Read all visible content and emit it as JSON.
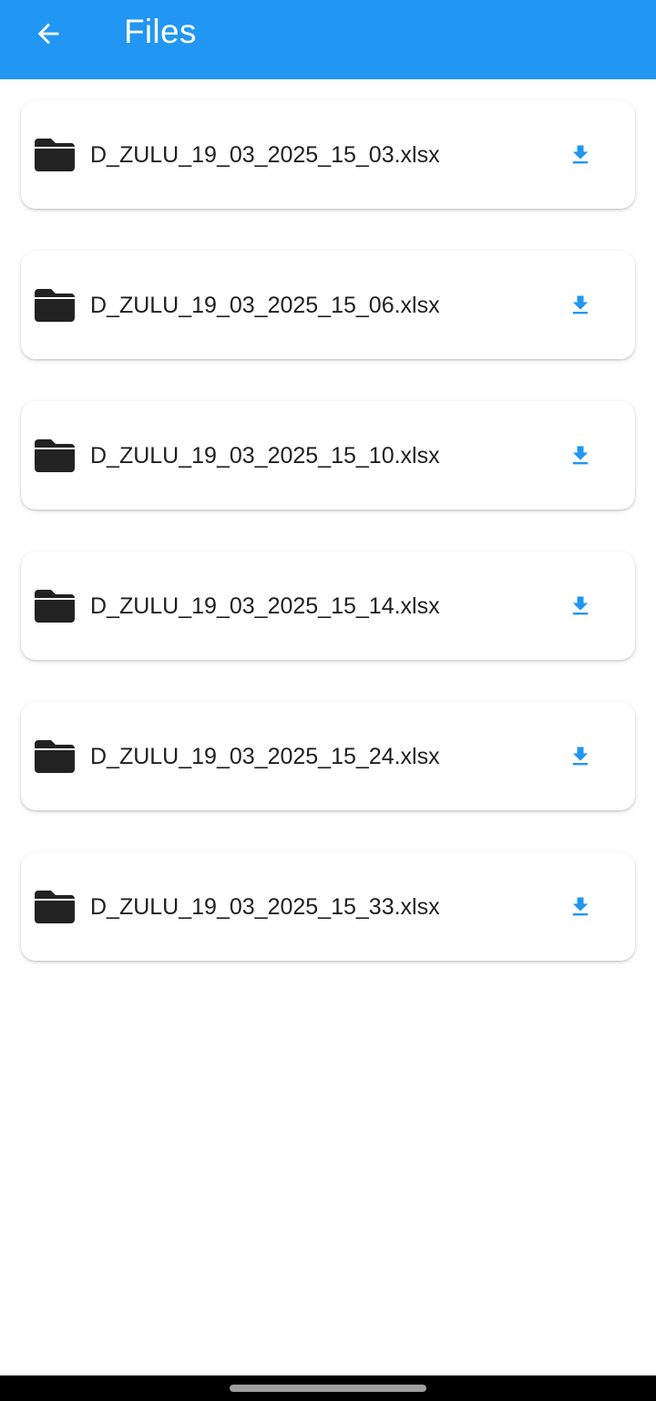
{
  "app_bar": {
    "title": "Files",
    "background_color": "#2196F3",
    "back_icon": "arrow-left-icon"
  },
  "files": [
    {
      "name": "D_ZULU_19_03_2025_15_03.xlsx",
      "icon": "folder-icon",
      "action_icon": "download-icon"
    },
    {
      "name": "D_ZULU_19_03_2025_15_06.xlsx",
      "icon": "folder-icon",
      "action_icon": "download-icon"
    },
    {
      "name": "D_ZULU_19_03_2025_15_10.xlsx",
      "icon": "folder-icon",
      "action_icon": "download-icon"
    },
    {
      "name": "D_ZULU_19_03_2025_15_14.xlsx",
      "icon": "folder-icon",
      "action_icon": "download-icon"
    },
    {
      "name": "D_ZULU_19_03_2025_15_24.xlsx",
      "icon": "folder-icon",
      "action_icon": "download-icon"
    },
    {
      "name": "D_ZULU_19_03_2025_15_33.xlsx",
      "icon": "folder-icon",
      "action_icon": "download-icon"
    }
  ],
  "colors": {
    "accent": "#2196F3",
    "folder": "#222222",
    "text": "#1f1f1f",
    "card_background": "#ffffff"
  }
}
